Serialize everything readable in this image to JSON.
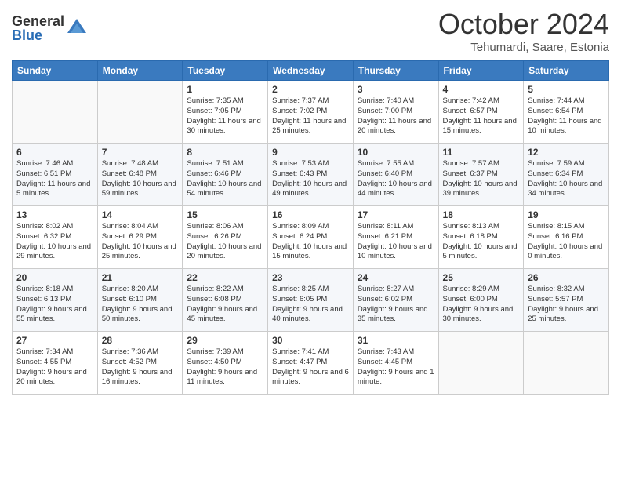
{
  "header": {
    "logo_general": "General",
    "logo_blue": "Blue",
    "month_title": "October 2024",
    "subtitle": "Tehumardi, Saare, Estonia"
  },
  "days_of_week": [
    "Sunday",
    "Monday",
    "Tuesday",
    "Wednesday",
    "Thursday",
    "Friday",
    "Saturday"
  ],
  "weeks": [
    [
      {
        "day": "",
        "info": ""
      },
      {
        "day": "",
        "info": ""
      },
      {
        "day": "1",
        "info": "Sunrise: 7:35 AM\nSunset: 7:05 PM\nDaylight: 11 hours and 30 minutes."
      },
      {
        "day": "2",
        "info": "Sunrise: 7:37 AM\nSunset: 7:02 PM\nDaylight: 11 hours and 25 minutes."
      },
      {
        "day": "3",
        "info": "Sunrise: 7:40 AM\nSunset: 7:00 PM\nDaylight: 11 hours and 20 minutes."
      },
      {
        "day": "4",
        "info": "Sunrise: 7:42 AM\nSunset: 6:57 PM\nDaylight: 11 hours and 15 minutes."
      },
      {
        "day": "5",
        "info": "Sunrise: 7:44 AM\nSunset: 6:54 PM\nDaylight: 11 hours and 10 minutes."
      }
    ],
    [
      {
        "day": "6",
        "info": "Sunrise: 7:46 AM\nSunset: 6:51 PM\nDaylight: 11 hours and 5 minutes."
      },
      {
        "day": "7",
        "info": "Sunrise: 7:48 AM\nSunset: 6:48 PM\nDaylight: 10 hours and 59 minutes."
      },
      {
        "day": "8",
        "info": "Sunrise: 7:51 AM\nSunset: 6:46 PM\nDaylight: 10 hours and 54 minutes."
      },
      {
        "day": "9",
        "info": "Sunrise: 7:53 AM\nSunset: 6:43 PM\nDaylight: 10 hours and 49 minutes."
      },
      {
        "day": "10",
        "info": "Sunrise: 7:55 AM\nSunset: 6:40 PM\nDaylight: 10 hours and 44 minutes."
      },
      {
        "day": "11",
        "info": "Sunrise: 7:57 AM\nSunset: 6:37 PM\nDaylight: 10 hours and 39 minutes."
      },
      {
        "day": "12",
        "info": "Sunrise: 7:59 AM\nSunset: 6:34 PM\nDaylight: 10 hours and 34 minutes."
      }
    ],
    [
      {
        "day": "13",
        "info": "Sunrise: 8:02 AM\nSunset: 6:32 PM\nDaylight: 10 hours and 29 minutes."
      },
      {
        "day": "14",
        "info": "Sunrise: 8:04 AM\nSunset: 6:29 PM\nDaylight: 10 hours and 25 minutes."
      },
      {
        "day": "15",
        "info": "Sunrise: 8:06 AM\nSunset: 6:26 PM\nDaylight: 10 hours and 20 minutes."
      },
      {
        "day": "16",
        "info": "Sunrise: 8:09 AM\nSunset: 6:24 PM\nDaylight: 10 hours and 15 minutes."
      },
      {
        "day": "17",
        "info": "Sunrise: 8:11 AM\nSunset: 6:21 PM\nDaylight: 10 hours and 10 minutes."
      },
      {
        "day": "18",
        "info": "Sunrise: 8:13 AM\nSunset: 6:18 PM\nDaylight: 10 hours and 5 minutes."
      },
      {
        "day": "19",
        "info": "Sunrise: 8:15 AM\nSunset: 6:16 PM\nDaylight: 10 hours and 0 minutes."
      }
    ],
    [
      {
        "day": "20",
        "info": "Sunrise: 8:18 AM\nSunset: 6:13 PM\nDaylight: 9 hours and 55 minutes."
      },
      {
        "day": "21",
        "info": "Sunrise: 8:20 AM\nSunset: 6:10 PM\nDaylight: 9 hours and 50 minutes."
      },
      {
        "day": "22",
        "info": "Sunrise: 8:22 AM\nSunset: 6:08 PM\nDaylight: 9 hours and 45 minutes."
      },
      {
        "day": "23",
        "info": "Sunrise: 8:25 AM\nSunset: 6:05 PM\nDaylight: 9 hours and 40 minutes."
      },
      {
        "day": "24",
        "info": "Sunrise: 8:27 AM\nSunset: 6:02 PM\nDaylight: 9 hours and 35 minutes."
      },
      {
        "day": "25",
        "info": "Sunrise: 8:29 AM\nSunset: 6:00 PM\nDaylight: 9 hours and 30 minutes."
      },
      {
        "day": "26",
        "info": "Sunrise: 8:32 AM\nSunset: 5:57 PM\nDaylight: 9 hours and 25 minutes."
      }
    ],
    [
      {
        "day": "27",
        "info": "Sunrise: 7:34 AM\nSunset: 4:55 PM\nDaylight: 9 hours and 20 minutes."
      },
      {
        "day": "28",
        "info": "Sunrise: 7:36 AM\nSunset: 4:52 PM\nDaylight: 9 hours and 16 minutes."
      },
      {
        "day": "29",
        "info": "Sunrise: 7:39 AM\nSunset: 4:50 PM\nDaylight: 9 hours and 11 minutes."
      },
      {
        "day": "30",
        "info": "Sunrise: 7:41 AM\nSunset: 4:47 PM\nDaylight: 9 hours and 6 minutes."
      },
      {
        "day": "31",
        "info": "Sunrise: 7:43 AM\nSunset: 4:45 PM\nDaylight: 9 hours and 1 minute."
      },
      {
        "day": "",
        "info": ""
      },
      {
        "day": "",
        "info": ""
      }
    ]
  ]
}
